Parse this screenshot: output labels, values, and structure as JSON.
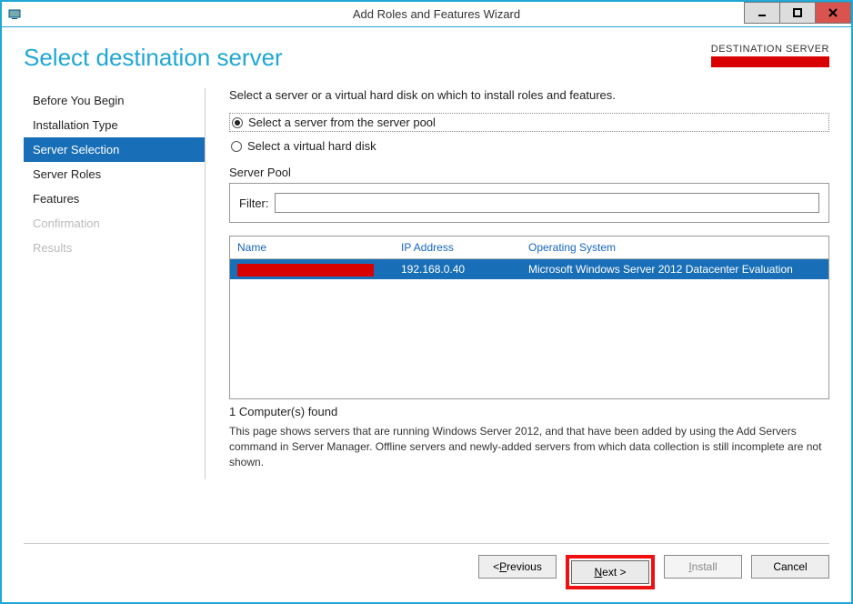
{
  "titlebar": {
    "title": "Add Roles and Features Wizard"
  },
  "header": {
    "page_title": "Select destination server",
    "dest_label": "DESTINATION SERVER"
  },
  "nav": {
    "items": [
      {
        "label": "Before You Begin",
        "state": "normal"
      },
      {
        "label": "Installation Type",
        "state": "normal"
      },
      {
        "label": "Server Selection",
        "state": "selected"
      },
      {
        "label": "Server Roles",
        "state": "normal"
      },
      {
        "label": "Features",
        "state": "normal"
      },
      {
        "label": "Confirmation",
        "state": "disabled"
      },
      {
        "label": "Results",
        "state": "disabled"
      }
    ]
  },
  "main": {
    "instruction": "Select a server or a virtual hard disk on which to install roles and features.",
    "radio_pool": "Select a server from the server pool",
    "radio_vhd": "Select a virtual hard disk",
    "section_label": "Server Pool",
    "filter_label": "Filter:",
    "filter_value": "",
    "columns": {
      "name": "Name",
      "ip": "IP Address",
      "os": "Operating System"
    },
    "rows": [
      {
        "name_redacted": true,
        "ip": "192.168.0.40",
        "os": "Microsoft Windows Server 2012 Datacenter Evaluation"
      }
    ],
    "count": "1 Computer(s) found",
    "note": "This page shows servers that are running Windows Server 2012, and that have been added by using the Add Servers command in Server Manager. Offline servers and newly-added servers from which data collection is still incomplete are not shown."
  },
  "footer": {
    "previous": "< Previous",
    "next": "Next >",
    "install": "Install",
    "cancel": "Cancel"
  }
}
